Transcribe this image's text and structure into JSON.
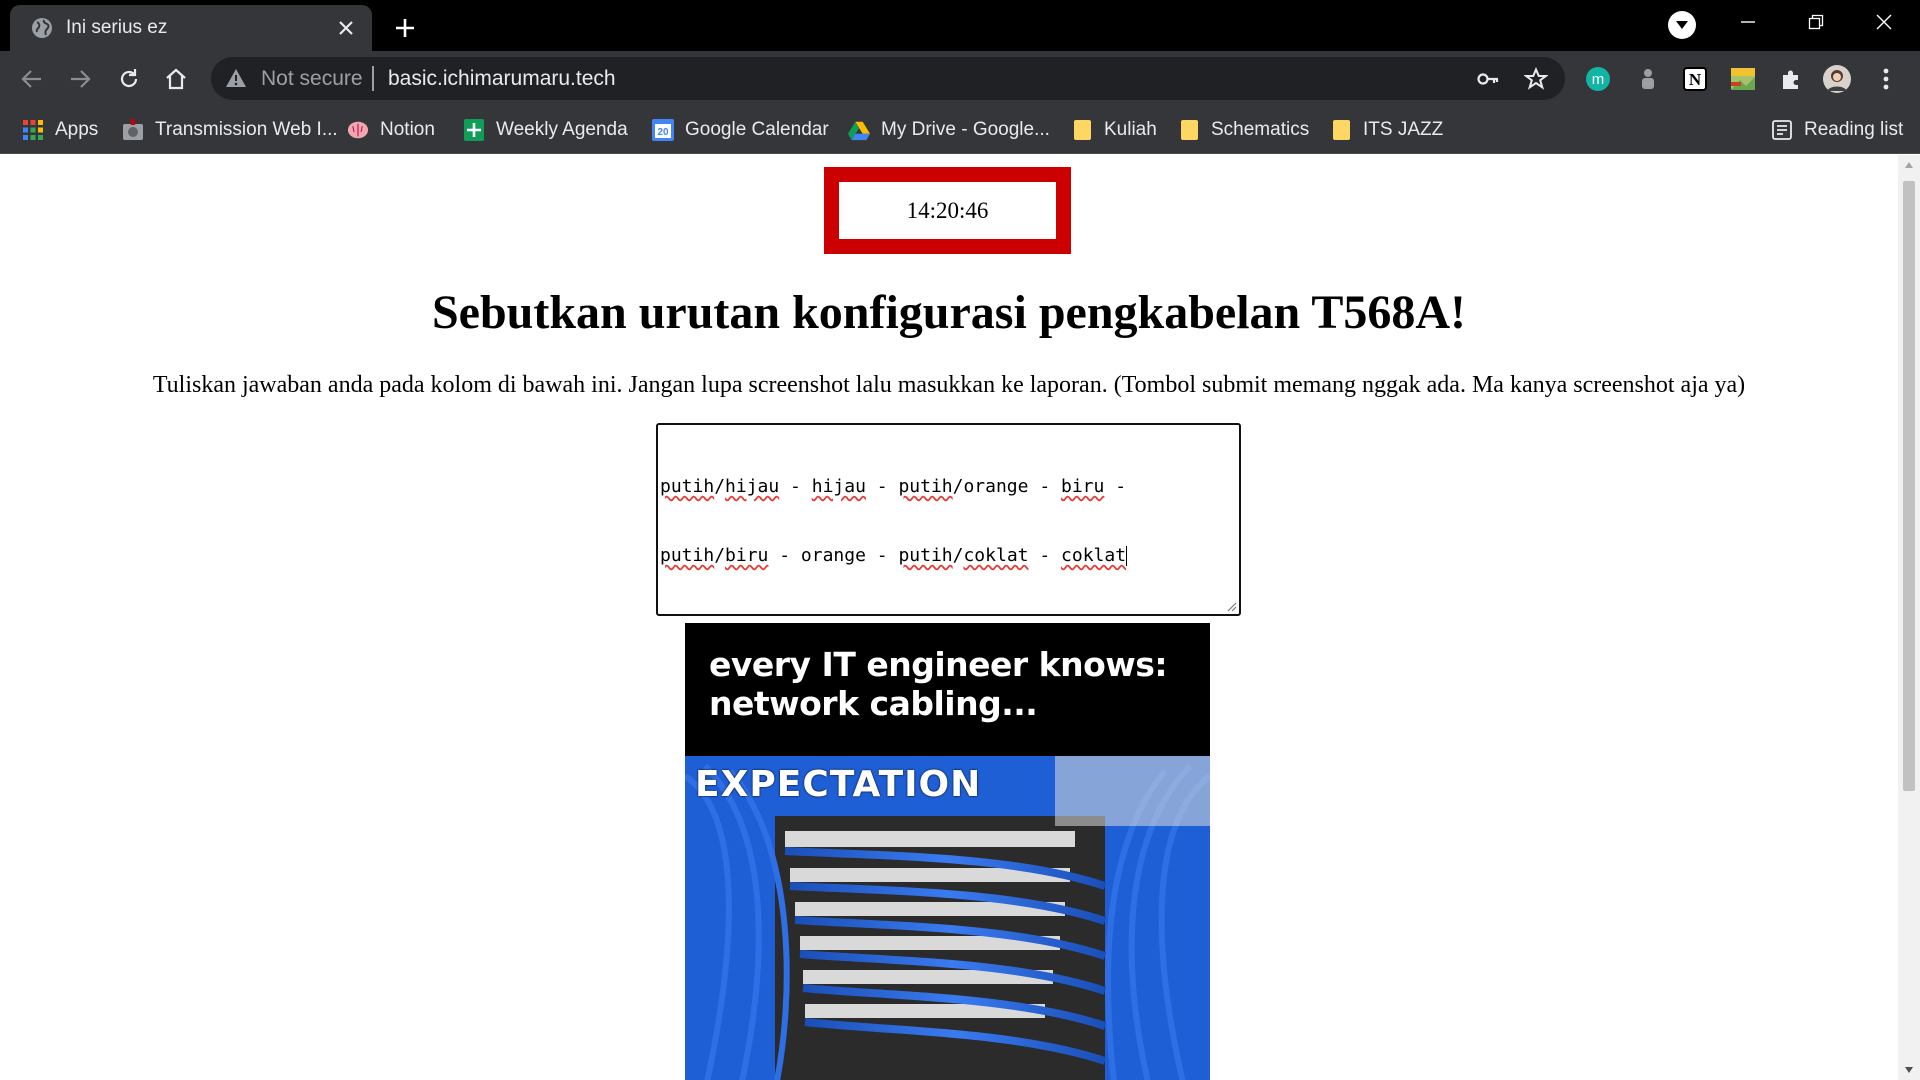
{
  "browser": {
    "tab": {
      "title": "Ini serius ez"
    },
    "address_bar": {
      "security_label": "Not secure",
      "url": "basic.ichimarumaru.tech"
    },
    "extensions": [
      {
        "icon": "extension-m-icon",
        "label": "m",
        "color": "#12b5a5"
      },
      {
        "icon": "extension-gray-icon"
      },
      {
        "icon": "notion-extension-icon",
        "label": "N"
      },
      {
        "icon": "extension-image-icon"
      },
      {
        "icon": "puzzle-icon"
      },
      {
        "icon": "avatar"
      }
    ],
    "bookmarks": [
      {
        "label": "Apps",
        "icon": "apps-grid-icon"
      },
      {
        "label": "Transmission Web I...",
        "icon": "transmission-icon"
      },
      {
        "label": "Notion",
        "icon": "brain-icon"
      },
      {
        "label": "Weekly Agenda",
        "icon": "sheets-icon"
      },
      {
        "label": "Google Calendar",
        "icon": "calendar-icon",
        "badge": "20"
      },
      {
        "label": "My Drive - Google...",
        "icon": "drive-icon"
      },
      {
        "label": "Kuliah",
        "icon": "folder-icon"
      },
      {
        "label": "Schematics",
        "icon": "folder-icon"
      },
      {
        "label": "ITS JAZZ",
        "icon": "folder-icon"
      }
    ],
    "reading_list_label": "Reading list",
    "colors": {
      "chrome_dark": "#35363a",
      "tabstrip": "#000000",
      "omnibox": "#202124"
    }
  },
  "page": {
    "clock": "14:20:46",
    "clock_border_color": "#cc0000",
    "question": "Sebutkan urutan konfigurasi pengkabelan T568A!",
    "instructions": "Tuliskan jawaban anda pada kolom di bawah ini. Jangan lupa screenshot lalu masukkan ke laporan. (Tombol submit memang nggak ada. Ma kanya screenshot aja ya)",
    "answer": {
      "line1": [
        {
          "t": "putih",
          "sp": true
        },
        {
          "t": "/"
        },
        {
          "t": "hijau",
          "sp": true
        },
        {
          "t": " - "
        },
        {
          "t": "hijau",
          "sp": true
        },
        {
          "t": " - "
        },
        {
          "t": "putih",
          "sp": true
        },
        {
          "t": "/orange - "
        },
        {
          "t": "biru",
          "sp": true
        },
        {
          "t": " -"
        }
      ],
      "line2": [
        {
          "t": "putih",
          "sp": true
        },
        {
          "t": "/"
        },
        {
          "t": "biru",
          "sp": true
        },
        {
          "t": " - orange - "
        },
        {
          "t": "putih",
          "sp": true
        },
        {
          "t": "/"
        },
        {
          "t": "coklat",
          "sp": true
        },
        {
          "t": " - "
        },
        {
          "t": "coklat",
          "sp": true
        }
      ]
    },
    "meme": {
      "caption_line1": "every IT engineer knows:",
      "caption_line2": "network cabling...",
      "label": "EXPECTATION",
      "cable_color": "#1f5fd6"
    }
  }
}
